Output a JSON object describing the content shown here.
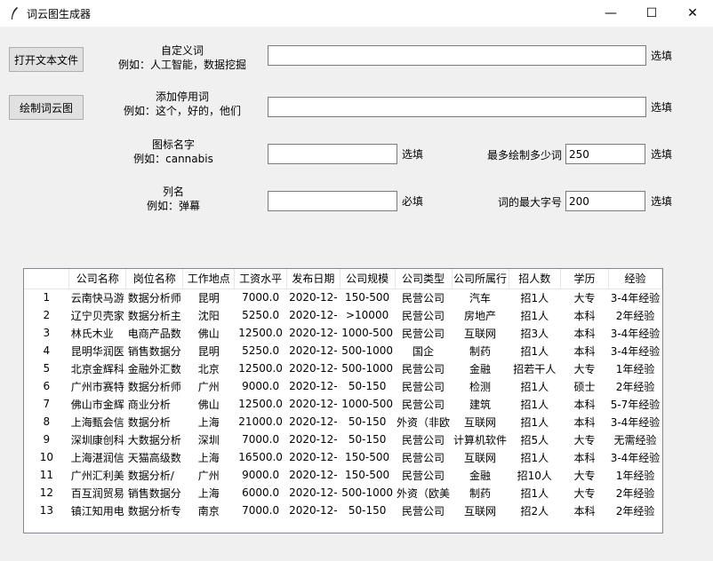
{
  "window": {
    "title": "词云图生成器",
    "minimize": "—",
    "maximize": "☐",
    "close": "✕"
  },
  "buttons": {
    "open_file": "打开文本文件",
    "draw": "绘制词云图"
  },
  "custom_words": {
    "title": "自定义词",
    "example": "例如：人工智能，数据挖掘",
    "value": "",
    "hint": "选填"
  },
  "stopwords": {
    "title": "添加停用词",
    "example": "例如：这个，好的，他们",
    "value": "",
    "hint": "选填"
  },
  "icon_name": {
    "title": "图标名字",
    "example": "例如：cannabis",
    "value": "",
    "hint": "选填"
  },
  "column_name": {
    "title": "列名",
    "example": "例如：弹幕",
    "value": "",
    "hint": "必填"
  },
  "max_words": {
    "label": "最多绘制多少词",
    "value": "250",
    "hint": "选填"
  },
  "max_font": {
    "label": "词的最大字号",
    "value": "200",
    "hint": "选填"
  },
  "table": {
    "headers": [
      "",
      "公司名称",
      "岗位名称",
      "工作地点",
      "工资水平",
      "发布日期",
      "公司规模",
      "公司类型",
      "公司所属行",
      "招人数",
      "学历",
      "经验"
    ],
    "rows": [
      [
        "1",
        "云南快马游",
        "数据分析师",
        "昆明",
        "7000.0",
        "2020-12-",
        "150-500",
        "民营公司",
        "汽车",
        "招1人",
        "大专",
        "3-4年经验"
      ],
      [
        "2",
        "辽宁贝壳家",
        "数据分析主",
        "沈阳",
        "5250.0",
        "2020-12-",
        ">10000",
        "民营公司",
        "房地产",
        "招1人",
        "本科",
        "2年经验"
      ],
      [
        "3",
        "林氏木业",
        "电商产品数",
        "佛山",
        "12500.0",
        "2020-12-",
        "1000-500",
        "民营公司",
        "互联网",
        "招3人",
        "本科",
        "3-4年经验"
      ],
      [
        "4",
        "昆明华润医",
        "销售数据分",
        "昆明",
        "5250.0",
        "2020-12-",
        "500-1000",
        "国企",
        "制药",
        "招1人",
        "本科",
        "3-4年经验"
      ],
      [
        "5",
        "北京金辉科",
        "金融外汇数",
        "北京",
        "12500.0",
        "2020-12-",
        "500-1000",
        "民营公司",
        "金融",
        "招若干人",
        "大专",
        "1年经验"
      ],
      [
        "6",
        "广州市赛特",
        "数据分析师",
        "广州",
        "9000.0",
        "2020-12-",
        "50-150",
        "民营公司",
        "检测",
        "招1人",
        "硕士",
        "2年经验"
      ],
      [
        "7",
        "佛山市金辉",
        "商业分析",
        "佛山",
        "12500.0",
        "2020-12-",
        "1000-500",
        "民营公司",
        "建筑",
        "招1人",
        "本科",
        "5-7年经验"
      ],
      [
        "8",
        "上海甄会信",
        "数据分析",
        "上海",
        "21000.0",
        "2020-12-",
        "50-150",
        "外资（非欧",
        "互联网",
        "招1人",
        "本科",
        "3-4年经验"
      ],
      [
        "9",
        "深圳康创科",
        "大数据分析",
        "深圳",
        "7000.0",
        "2020-12-",
        "50-150",
        "民营公司",
        "计算机软件",
        "招5人",
        "大专",
        "无需经验"
      ],
      [
        "10",
        "上海湛润信",
        "天猫高级数",
        "上海",
        "16500.0",
        "2020-12-",
        "150-500",
        "民营公司",
        "互联网",
        "招1人",
        "本科",
        "3-4年经验"
      ],
      [
        "11",
        "广州汇利美",
        "数据分析/",
        "广州",
        "9000.0",
        "2020-12-",
        "150-500",
        "民营公司",
        "金融",
        "招10人",
        "大专",
        "1年经验"
      ],
      [
        "12",
        "百互润贸易",
        "销售数据分",
        "上海",
        "6000.0",
        "2020-12-",
        "500-1000",
        "外资（欧美",
        "制药",
        "招1人",
        "大专",
        "2年经验"
      ],
      [
        "13",
        "镇江知用电",
        "数据分析专",
        "南京",
        "7000.0",
        "2020-12-",
        "50-150",
        "民营公司",
        "互联网",
        "招2人",
        "本科",
        "2年经验"
      ]
    ]
  }
}
